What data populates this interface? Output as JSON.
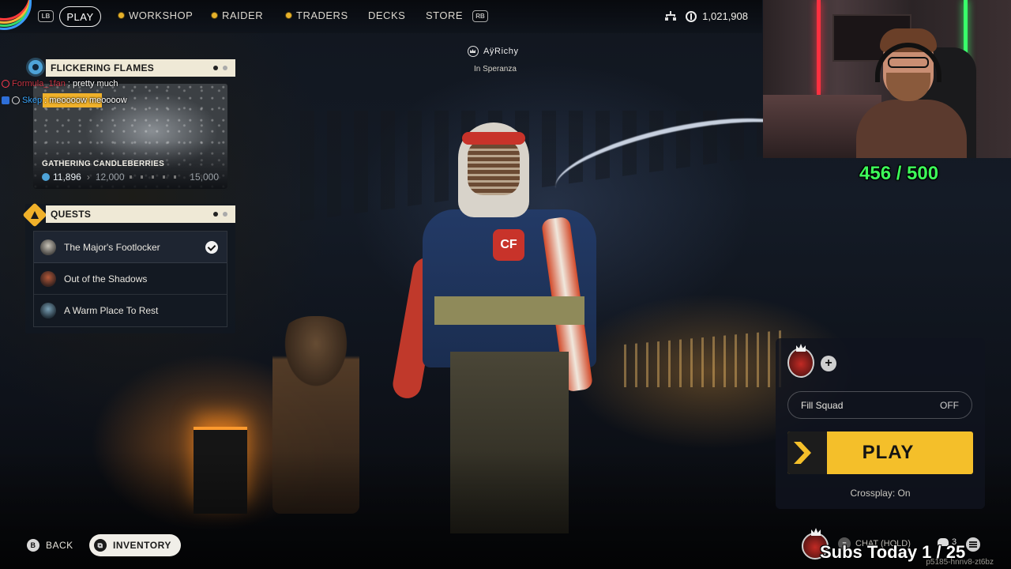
{
  "nav": {
    "lb": "LB",
    "rb": "RB",
    "play": "PLAY",
    "items": [
      "WORKSHOP",
      "RAIDER",
      "TRADERS",
      "DECKS",
      "STORE"
    ],
    "currency": "1,021,908"
  },
  "player": {
    "name": "AÿRichy",
    "location": "In Speranza"
  },
  "event": {
    "header": "FLICKERING FLAMES",
    "card_title": "GATHERING CANDLEBERRIES",
    "current": "11,896",
    "next": "12,000",
    "max": "15,000"
  },
  "chat": [
    {
      "user": "Formula_1fan",
      "message": ": pretty much"
    },
    {
      "user": "Skep",
      "message": ": meoooow meoooow"
    }
  ],
  "quests": {
    "header": "QUESTS",
    "items": [
      {
        "label": "The Major's Footlocker",
        "done": true
      },
      {
        "label": "Out of the Shadows",
        "done": false
      },
      {
        "label": "A Warm Place To Rest",
        "done": false
      }
    ]
  },
  "stream": {
    "goal": "456 / 500",
    "subs_today": "Subs Today  1 / 25"
  },
  "play_panel": {
    "add": "+",
    "fill_squad_label": "Fill Squad",
    "fill_squad_value": "OFF",
    "play_label": "PLAY",
    "crossplay": "Crossplay: On"
  },
  "bottom": {
    "back_key": "B",
    "back": "BACK",
    "inventory": "INVENTORY",
    "chat_hold": "CHAT (HOLD)",
    "squad_count": "3",
    "build_id": "p5185-hnnv8-zt6bz"
  },
  "colors": {
    "accent": "#f4bf2a",
    "goal_green": "#3dfc59",
    "panel_header": "#efe9d6"
  }
}
